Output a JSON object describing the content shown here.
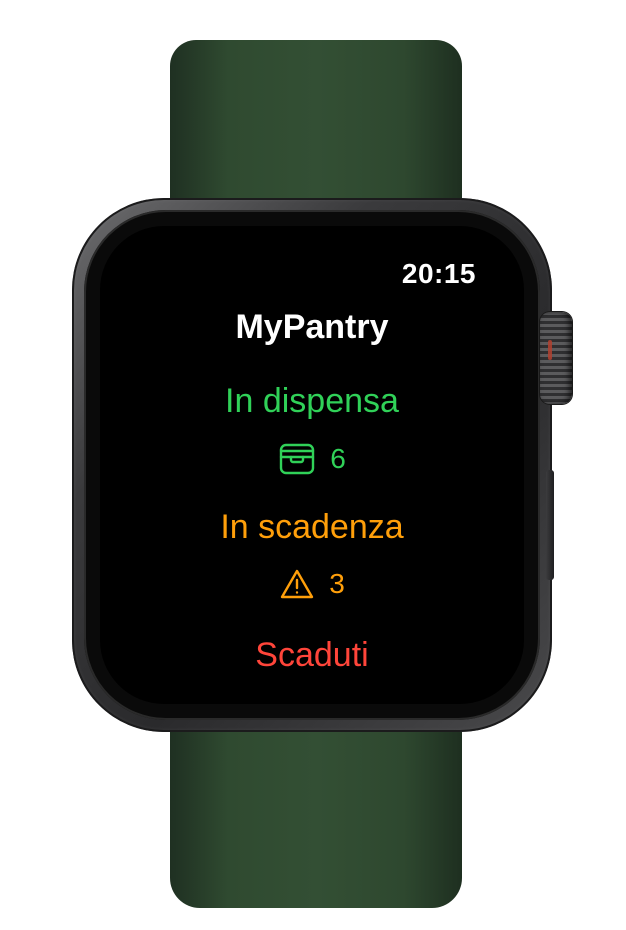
{
  "status": {
    "time": "20:15"
  },
  "app": {
    "title": "MyPantry"
  },
  "sections": {
    "in_pantry": {
      "label": "In dispensa",
      "count": "6",
      "icon": "tray-icon",
      "color": "#30d158"
    },
    "expiring": {
      "label": "In scadenza",
      "count": "3",
      "icon": "warning-triangle-icon",
      "color": "#ff9f0a"
    },
    "expired": {
      "label": "Scaduti",
      "color": "#ff453a"
    }
  }
}
